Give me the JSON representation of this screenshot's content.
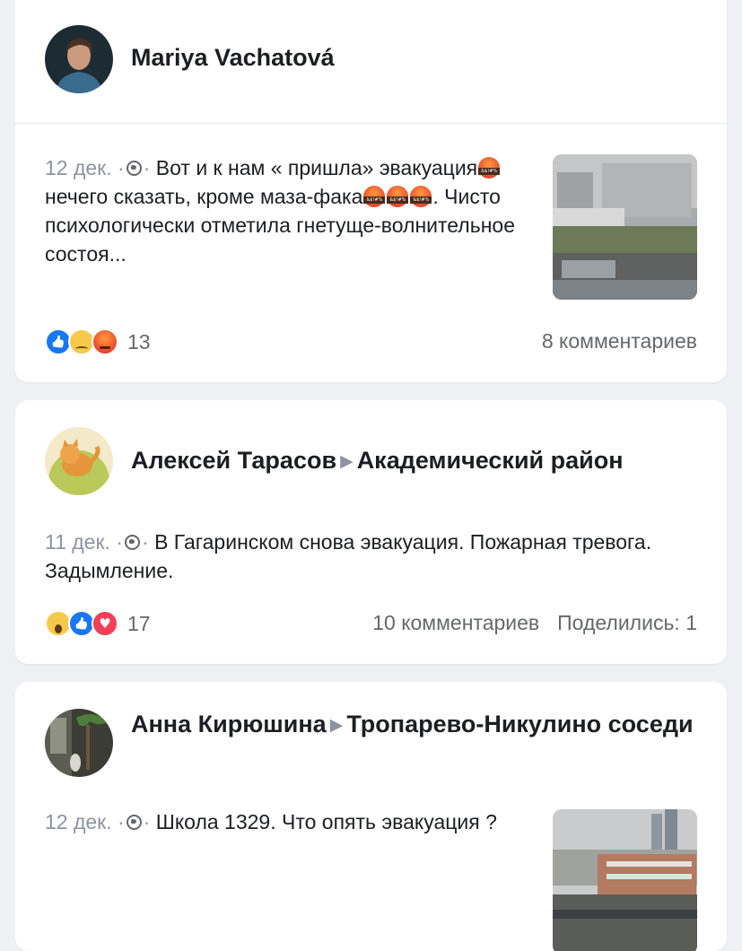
{
  "posts": [
    {
      "author": "Mariya Vachatová",
      "date": "12 дек.",
      "separator": "·",
      "text_parts": [
        "Вот и к нам « пришла» эвакуация",
        " нечего сказать, кроме маза-фака",
        ". Чисто психологически отметила гнетуще-волнительное состоя..."
      ],
      "reactions": [
        "like-icon",
        "sad-icon",
        "angry-icon"
      ],
      "reaction_count": "13",
      "comments": "8 комментариев",
      "has_image": true
    },
    {
      "author": "Алексей Тарасов",
      "group": "Академический район",
      "date": "11 дек.",
      "separator": "·",
      "text": "В Гагаринском снова эвакуация. Пожарная тревога. Задымление.",
      "reactions": [
        "wow-icon",
        "like-icon",
        "love-icon"
      ],
      "reaction_count": "17",
      "comments": "10 комментариев",
      "shares": "Поделились: 1"
    },
    {
      "author": "Анна Кирюшина",
      "group": "Тропарево-Никулино соседи",
      "date": "12 дек.",
      "separator": "·",
      "text": "Школа 1329. Что опять эвакуация ?",
      "has_image": true
    }
  ],
  "colors": {
    "background": "#eef0f3",
    "card": "#ffffff",
    "text": "#1c1e21",
    "muted": "#65676b",
    "like": "#1877f2",
    "love": "#f33e58"
  }
}
